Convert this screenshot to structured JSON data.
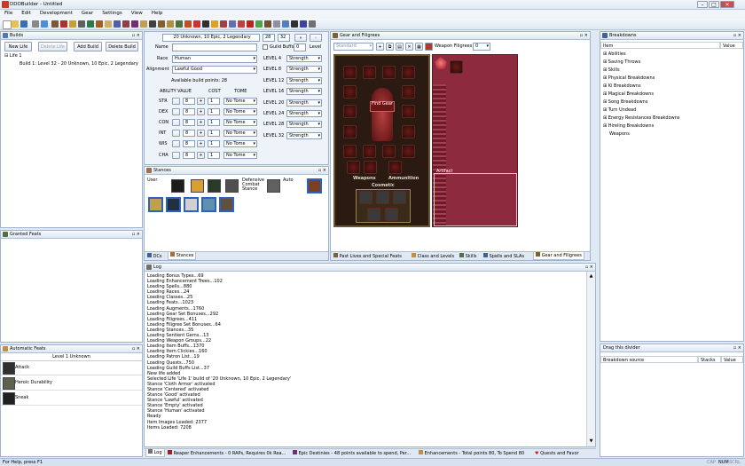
{
  "app": {
    "title": "DDOBuilder - Untitled"
  },
  "menu": [
    "File",
    "Edit",
    "Development",
    "Gear",
    "Settings",
    "View",
    "Help"
  ],
  "builds_panel": {
    "title": "Builds",
    "buttons": {
      "new_life": "New Life",
      "delete_life": "Delete Life",
      "add_build": "Add Build",
      "delete_build": "Delete Build"
    },
    "tree": {
      "life": "Life 1",
      "build": "Build 1: Level 32 - 20 Unknown, 10 Epic, 2 Legendary"
    }
  },
  "character": {
    "summary": "20 Unknown, 10 Epic, 2 Legendary",
    "level_a": "28",
    "level_b": "32",
    "guild_buffs_label": "Guild Buffs",
    "guild_level_value": "0",
    "guild_level_label": "Level",
    "name_label": "Name",
    "name_value": "",
    "race_label": "Race",
    "race_value": "Human",
    "alignment_label": "Alignment",
    "alignment_value": "Lawful Good",
    "build_points": "Available build points: 28",
    "headers": {
      "ability": "ABILITY",
      "value": "VALUE",
      "cost": "COST",
      "tome": "TOME"
    },
    "abilities": [
      {
        "name": "STR",
        "value": "8",
        "cost": "1",
        "tome": "No Tome"
      },
      {
        "name": "DEX",
        "value": "8",
        "cost": "1",
        "tome": "No Tome"
      },
      {
        "name": "CON",
        "value": "8",
        "cost": "1",
        "tome": "No Tome"
      },
      {
        "name": "INT",
        "value": "8",
        "cost": "1",
        "tome": "No Tome"
      },
      {
        "name": "WIS",
        "value": "8",
        "cost": "1",
        "tome": "No Tome"
      },
      {
        "name": "CHA",
        "value": "8",
        "cost": "1",
        "tome": "No Tome"
      }
    ],
    "level_ups": [
      {
        "level": "LEVEL 4",
        "stat": "Strength"
      },
      {
        "level": "LEVEL 8",
        "stat": "Strength"
      },
      {
        "level": "LEVEL 12",
        "stat": "Strength"
      },
      {
        "level": "LEVEL 16",
        "stat": "Strength"
      },
      {
        "level": "LEVEL 20",
        "stat": "Strength"
      },
      {
        "level": "LEVEL 24",
        "stat": "Strength"
      },
      {
        "level": "LEVEL 28",
        "stat": "Strength"
      },
      {
        "level": "LEVEL 32",
        "stat": "Strength"
      }
    ]
  },
  "stances": {
    "title": "Stances",
    "user_label": "User",
    "auto_label": "Auto",
    "defensive_label": "Defensive Combat Stance",
    "tabs": [
      "DCs",
      "Stances"
    ]
  },
  "gear": {
    "title": "Gear and Filigrees",
    "gearset": "Standard",
    "weapon_filigrees_label": "Weapon Filigrees",
    "weapon_filigrees_value": "0",
    "find_gear": "Find Gear",
    "weapons_label": "Weapons",
    "ammunition_label": "Ammunition",
    "cosmetic_label": "Cosmetic",
    "artifact_label": "Artifact",
    "tabs": [
      "Past Lives and Special Feats",
      "Class and Levels",
      "Skills",
      "Spells and SLAs",
      "Gear and Filigrees"
    ]
  },
  "granted_feats": {
    "title": "Granted Feats"
  },
  "automatic_feats": {
    "title": "Automatic Feats",
    "level_header": "Level 1 Unknown",
    "feats": [
      "Attack",
      "Heroic Durability",
      "Sneak"
    ]
  },
  "log": {
    "title": "Log",
    "lines": [
      "Loading Bonus Types...69",
      "Loading Enhancement Trees...102",
      "Loading Spells...880",
      "Loading Races...24",
      "Loading Classes...25",
      "Loading Feats...1023",
      "Loading Augments...1760",
      "Loading Gear Set Bonuses...292",
      "Loading Filigrees...411",
      "Loading Filigree Set Bonuses...64",
      "Loading Stances...35",
      "Loading Sentient Gems...13",
      "Loading Weapon Groups...22",
      "Loading Item Buffs...1370",
      "Loading Item Clickies...160",
      "Loading Patron List...19",
      "Loading Quests...750",
      "Loading Guild Buffs List...37",
      "New life added",
      "Selected Life 'Life 1' build of '20 Unknown, 10 Epic, 2 Legendary'",
      "Stance 'Cloth Armor' activated",
      "Stance 'Centered' activated",
      "Stance 'Good' activated",
      "Stance 'Lawful' activated",
      "Stance 'Empty' activated",
      "Stance 'Human' activated",
      "Ready",
      "Item Images Loaded: 2377",
      "Items Loaded: 7208"
    ]
  },
  "bottom_tabs": [
    "Log",
    "Reaper Enhancements - 0 RAPs, Requires 0k Rea...",
    "Epic Destinies - 48 points available to spend, Per...",
    "Enhancements - Total points 80, To Spend 80",
    "Quests and Favor"
  ],
  "breakdowns": {
    "title": "Breakdowns",
    "header_item": "Item",
    "header_value": "Value",
    "items": [
      "Abilities",
      "Saving Throws",
      "Skills",
      "Physical Breakdowns",
      "Ki Breakdowns",
      "Magical Breakdowns",
      "Song Breakdowns",
      "Turn Undead",
      "Energy Resistances Breakdowns",
      "Hireling Breakdowns",
      "Weapons"
    ],
    "divider": "Drag this divider",
    "source_header": "Breakdown source",
    "stacks_header": "Stacks",
    "value_header": "Value"
  },
  "status": {
    "left": "For Help, press F1",
    "caps": "CAP",
    "num": "NUM",
    "scrl": "SCRL"
  }
}
